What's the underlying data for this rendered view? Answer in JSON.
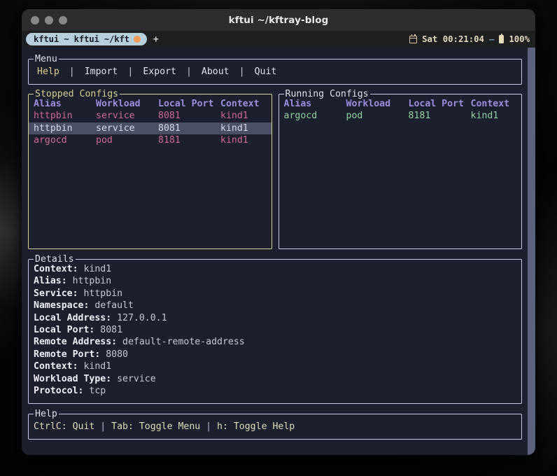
{
  "window": {
    "title": "kftui ~/kftray-blog",
    "traffic_lights": [
      "close-button",
      "minimize-button",
      "maximize-button"
    ]
  },
  "tabbar": {
    "tab_label": "kftui ~ kftui ~/kft",
    "tab_dot_color": "#ef9a56",
    "new_tab_label": "+",
    "status": {
      "calendar_icon": "calendar-icon",
      "clock": "Sat 00:21:04",
      "separator": "–",
      "battery_icon": "battery-icon",
      "battery_level": "100%"
    }
  },
  "menu": {
    "title": "Menu",
    "items": [
      {
        "label": "Help",
        "active": true
      },
      {
        "label": "Import",
        "active": false
      },
      {
        "label": "Export",
        "active": false
      },
      {
        "label": "About",
        "active": false
      },
      {
        "label": "Quit",
        "active": false
      }
    ],
    "separator": "|"
  },
  "columns": [
    "Alias",
    "Workload",
    "Local Port",
    "Context"
  ],
  "stopped": {
    "title": "Stopped Configs",
    "focused": true,
    "accent_color": "#d7cf8d",
    "row_color": "#d2678f",
    "header_color": "#a08cdf",
    "rows": [
      {
        "alias": "httpbin",
        "workload": "service",
        "port": "8081",
        "context": "kind1",
        "selected": false
      },
      {
        "alias": "httpbin",
        "workload": "service",
        "port": "8081",
        "context": "kind1",
        "selected": true
      },
      {
        "alias": "argocd",
        "workload": "pod",
        "port": "8181",
        "context": "kind1",
        "selected": false
      }
    ]
  },
  "running": {
    "title": "Running Configs",
    "focused": false,
    "row_color": "#8fd49b",
    "header_color": "#a08cdf",
    "rows": [
      {
        "alias": "argocd",
        "workload": "pod",
        "port": "8181",
        "context": "kind1",
        "selected": false
      }
    ]
  },
  "details": {
    "title": "Details",
    "fields": [
      {
        "key": "Context:",
        "value": "kind1"
      },
      {
        "key": "Alias:",
        "value": "httpbin"
      },
      {
        "key": "Service:",
        "value": "httpbin"
      },
      {
        "key": "Namespace:",
        "value": "default"
      },
      {
        "key": "Local Address:",
        "value": "127.0.0.1"
      },
      {
        "key": "Local Port:",
        "value": "8081"
      },
      {
        "key": "Remote Address:",
        "value": "default-remote-address"
      },
      {
        "key": "Remote Port:",
        "value": "8080"
      },
      {
        "key": "Context:",
        "value": "kind1"
      },
      {
        "key": "Workload Type:",
        "value": "service"
      },
      {
        "key": "Protocol:",
        "value": "tcp"
      }
    ]
  },
  "help": {
    "title": "Help",
    "entries": [
      "CtrlC: Quit",
      "Tab: Toggle Menu",
      "h: Toggle Help"
    ],
    "separator": "|"
  }
}
